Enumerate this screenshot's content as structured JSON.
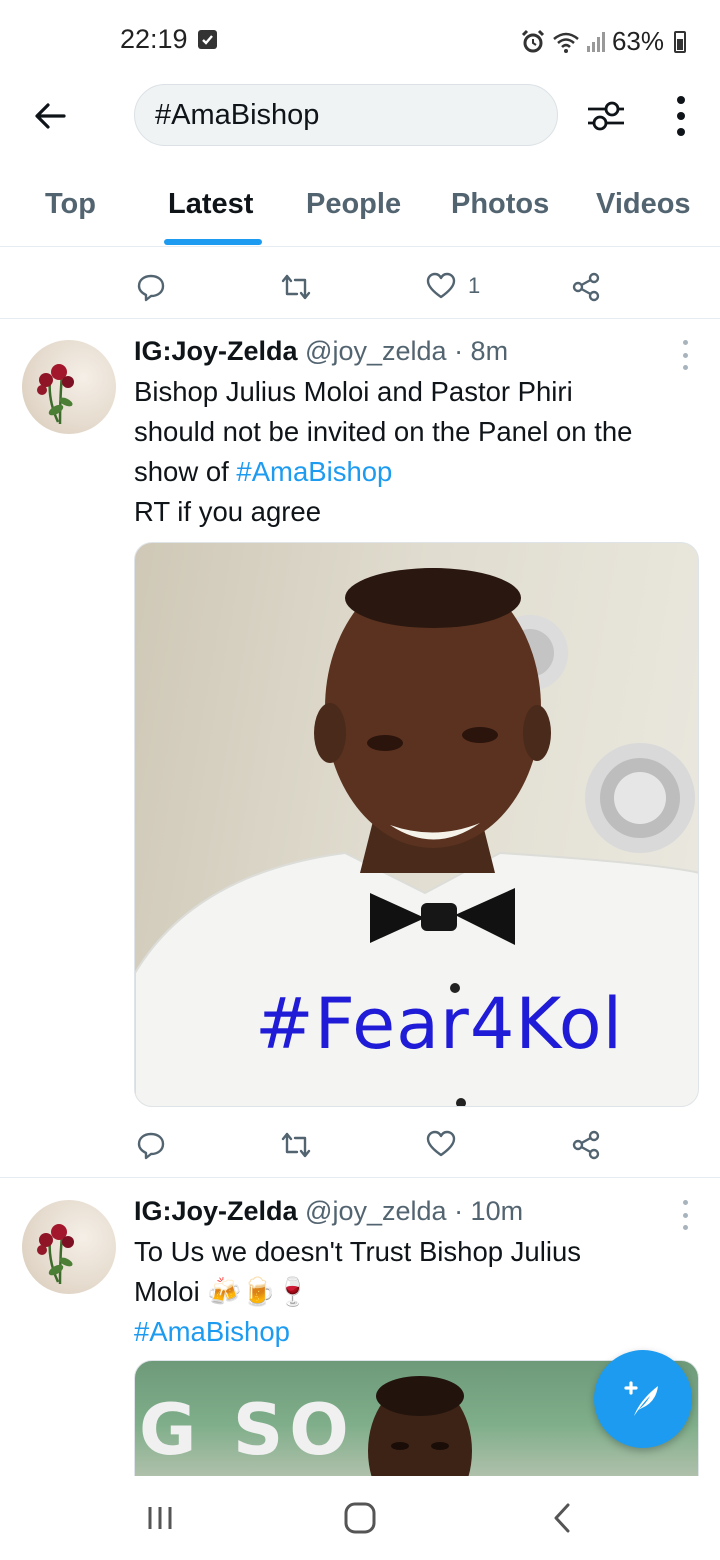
{
  "status_bar": {
    "time": "22:19",
    "battery": "63%"
  },
  "search": {
    "query": "#AmaBishop"
  },
  "tabs": [
    {
      "label": "Top",
      "active": false
    },
    {
      "label": "Latest",
      "active": true
    },
    {
      "label": "People",
      "active": false
    },
    {
      "label": "Photos",
      "active": false
    },
    {
      "label": "Videos",
      "active": false
    }
  ],
  "top_actions": {
    "like_count": "1"
  },
  "tweets": [
    {
      "name": "IG:Joy-Zelda",
      "handle": "@joy_zelda",
      "time": "· 8m",
      "text_lines": [
        "Bishop Julius Moloi and Pastor Phiri",
        "should not be invited on the Panel on the",
        "show of "
      ],
      "hashtag": "#AmaBishop",
      "text_after": "RT if you agree",
      "image_caption": "#Fear4Kol"
    },
    {
      "name": "IG:Joy-Zelda",
      "handle": "@joy_zelda",
      "time": "· 10m",
      "text_lines": [
        "To Us we doesn't Trust Bishop Julius",
        "Moloi "
      ],
      "emojis": "🍻🍺🍷",
      "hashtag": "#AmaBishop",
      "banner_text": "G SO"
    }
  ],
  "colors": {
    "accent": "#1d9bf0",
    "text": "#0f1419",
    "secondary": "#536471"
  },
  "icons": [
    "back-arrow-icon",
    "filter-icon",
    "more-icon",
    "reply-icon",
    "retweet-icon",
    "like-icon",
    "share-icon",
    "compose-icon",
    "recent-apps-icon",
    "home-icon",
    "back-icon"
  ]
}
